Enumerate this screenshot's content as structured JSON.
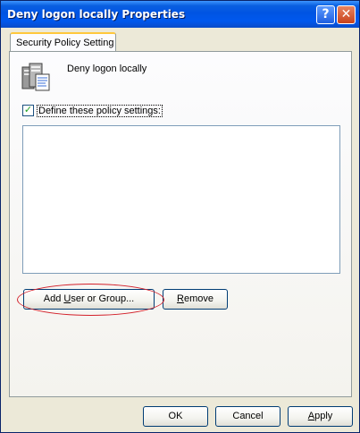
{
  "window": {
    "title": "Deny logon locally Properties"
  },
  "titlebar": {
    "help_label": "?",
    "close_label": "✕"
  },
  "tabs": [
    {
      "label": "Security Policy Setting"
    }
  ],
  "policy": {
    "icon": "policy-servers-icon",
    "name": "Deny logon locally"
  },
  "define_checkbox": {
    "checked": true,
    "mark": "✓",
    "label": "Define these policy settings:"
  },
  "list": {
    "items": []
  },
  "buttons": {
    "add_prefix": "Add ",
    "add_mnemonic": "U",
    "add_suffix": "ser or Group...",
    "remove_mnemonic": "R",
    "remove_suffix": "emove",
    "ok": "OK",
    "cancel": "Cancel",
    "apply_mnemonic": "A",
    "apply_suffix": "pply"
  },
  "colors": {
    "titlebar": "#0054e3",
    "face": "#ece9d8",
    "annotation": "#d3202a",
    "tab_highlight": "#ffc83c"
  }
}
